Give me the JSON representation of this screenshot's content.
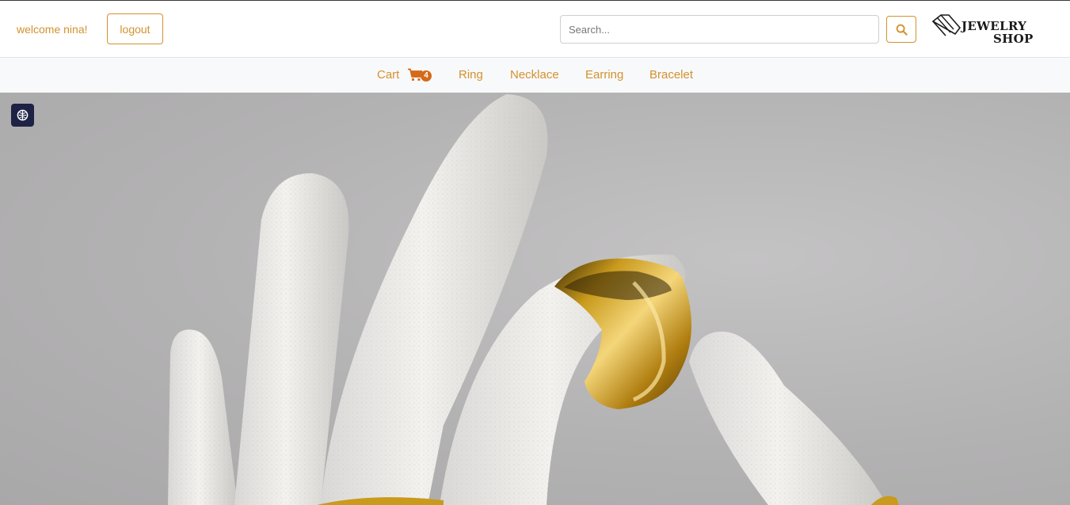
{
  "header": {
    "welcome_text": "welcome nina!",
    "logout_label": "logout",
    "search_placeholder": "Search...",
    "search_value": "",
    "logo_line1": "JEWELRY",
    "logo_line2": "SHOP"
  },
  "nav": {
    "cart_label": "Cart",
    "cart_count": "4",
    "items": [
      {
        "label": "Ring"
      },
      {
        "label": "Necklace"
      },
      {
        "label": "Earring"
      },
      {
        "label": "Bracelet"
      }
    ]
  },
  "hero": {
    "image_subject": "white plaster hand sculpture wearing a gold ring"
  },
  "colors": {
    "accent": "#d4912f",
    "badge": "#d46a1a",
    "nav_bg": "#f8f9fa",
    "a11y_button": "#1e2245",
    "hero_bg": "#b3b2b3",
    "gold": "#c99a1c"
  },
  "icons": {
    "search": "search-icon",
    "cart": "cart-icon",
    "accessibility": "accessibility-icon",
    "logo": "diamond-logo-icon"
  }
}
